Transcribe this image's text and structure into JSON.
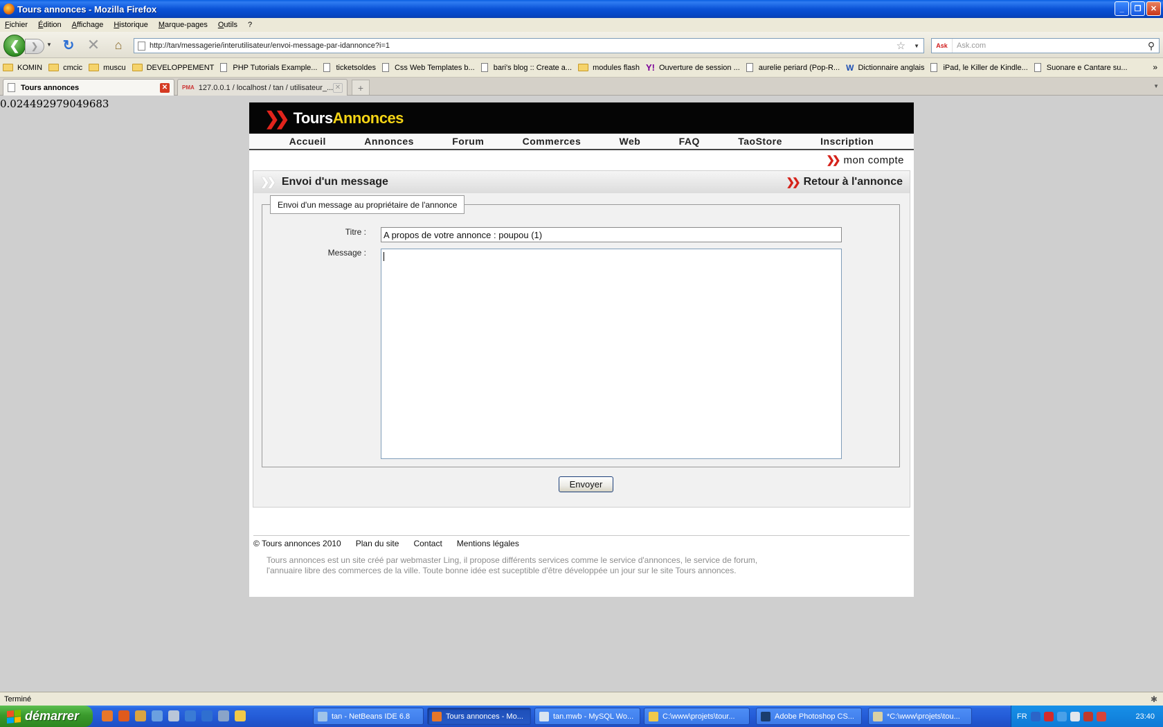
{
  "window": {
    "title": "Tours annonces - Mozilla Firefox"
  },
  "menu": [
    "Fichier",
    "Édition",
    "Affichage",
    "Historique",
    "Marque-pages",
    "Outils",
    "?"
  ],
  "navigation": {
    "url": "http://tan/messagerie/interutilisateur/envoi-message-par-idannonce?i=1",
    "search_engine": "Ask",
    "search_placeholder": "Ask.com"
  },
  "bookmarks": [
    {
      "label": "KOMIN",
      "icon": "folder-icon"
    },
    {
      "label": "cmcic",
      "icon": "folder-icon"
    },
    {
      "label": "muscu",
      "icon": "folder-icon"
    },
    {
      "label": "DEVELOPPEMENT",
      "icon": "folder-icon"
    },
    {
      "label": "PHP Tutorials Example...",
      "icon": "page-icon"
    },
    {
      "label": "ticketsoldes",
      "icon": "page-icon"
    },
    {
      "label": "Css Web Templates b...",
      "icon": "page-icon"
    },
    {
      "label": "bari's blog :: Create a...",
      "icon": "page-icon"
    },
    {
      "label": "modules flash",
      "icon": "folder-icon"
    },
    {
      "label": "Ouverture de session ...",
      "icon": "yahoo-icon"
    },
    {
      "label": "aurelie periard (Pop-R...",
      "icon": "page-icon"
    },
    {
      "label": "Dictionnaire anglais",
      "icon": "wordreference-icon"
    },
    {
      "label": "iPad, le Killer de Kindle...",
      "icon": "page-icon"
    },
    {
      "label": "Suonare e Cantare su...",
      "icon": "page-icon"
    }
  ],
  "tabs": [
    {
      "label": "Tours annonces",
      "active": true
    },
    {
      "label": "127.0.0.1 / localhost / tan / utilisateur_...",
      "active": false
    }
  ],
  "debug_value": "0.024492979049683",
  "site": {
    "logo_part1": "Tours",
    "logo_part2": "Annonces",
    "nav": [
      "Accueil",
      "Annonces",
      "Forum",
      "Commerces",
      "Web",
      "FAQ",
      "TaoStore",
      "Inscription"
    ],
    "account_link": "mon compte",
    "panel_title": "Envoi d'un message",
    "back_link": "Retour à l'annonce",
    "fieldset_legend": "Envoi d'un message au propriétaire de l'annonce",
    "form": {
      "title_label": "Titre :",
      "title_value": "A propos de votre annonce : poupou (1)",
      "message_label": "Message :",
      "message_value": "",
      "submit_label": "Envoyer"
    },
    "footer": {
      "copyright": "© Tours annonces 2010",
      "links": [
        "Plan du site",
        "Contact",
        "Mentions légales"
      ],
      "description": "Tours annonces est un site créé par webmaster Ling, il propose différents services comme le service d'annonces, le service de forum, l'annuaire libre des commerces de la ville. Toute bonne idée est suceptible d'être développée un jour sur le site Tours annonces."
    },
    "colors": {
      "header_bg": "#050505",
      "logo_yellow": "#f5d415",
      "accent_red": "#d5221a"
    }
  },
  "status": {
    "text": "Terminé"
  },
  "taskbar": {
    "start_label": "démarrer",
    "tasks": [
      {
        "label": "tan - NetBeans IDE 6.8",
        "active": false
      },
      {
        "label": "Tours annonces - Mo...",
        "active": true
      },
      {
        "label": "tan.mwb - MySQL Wo...",
        "active": false
      },
      {
        "label": "C:\\www\\projets\\tour...",
        "active": false
      },
      {
        "label": "Adobe Photoshop CS...",
        "active": false
      },
      {
        "label": "*C:\\www\\projets\\tou...",
        "active": false
      }
    ],
    "tray_lang": "FR",
    "clock": "23:40"
  }
}
